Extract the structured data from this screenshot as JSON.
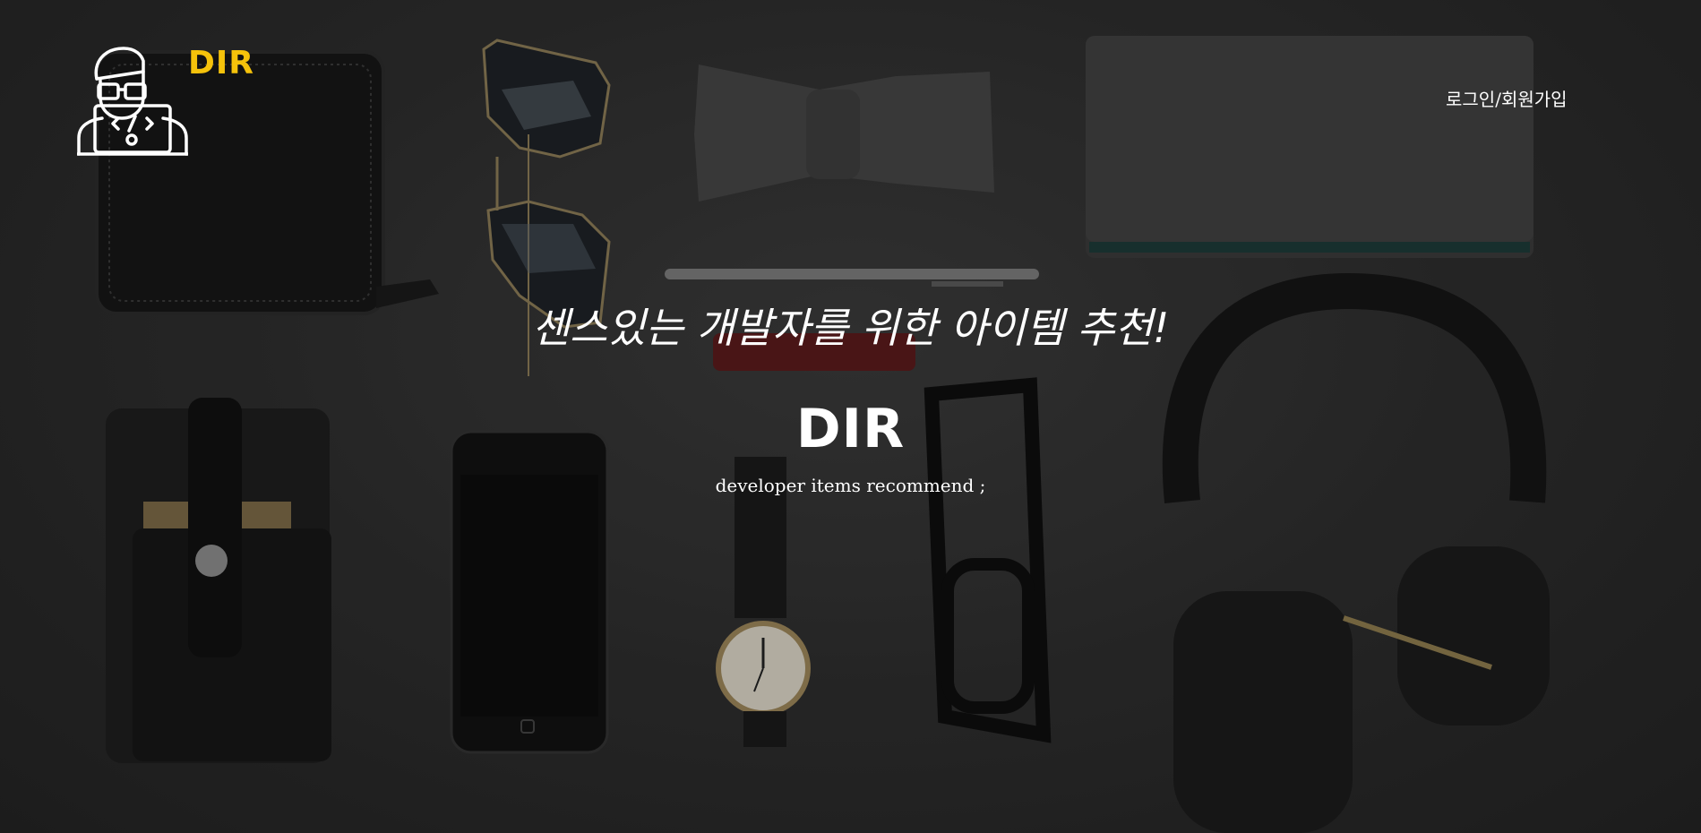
{
  "header": {
    "logo_text": "DIR",
    "login_link": "로그인/회원가입"
  },
  "hero": {
    "tagline": "센스있는 개발자를 위한 아이템 추천!",
    "title": "DIR",
    "subtitle": "developer items recommend ;"
  },
  "colors": {
    "accent": "#f5c20b",
    "text": "#ffffff",
    "background": "#2a2a2a"
  },
  "icons": {
    "logo": "developer-avatar-icon"
  }
}
